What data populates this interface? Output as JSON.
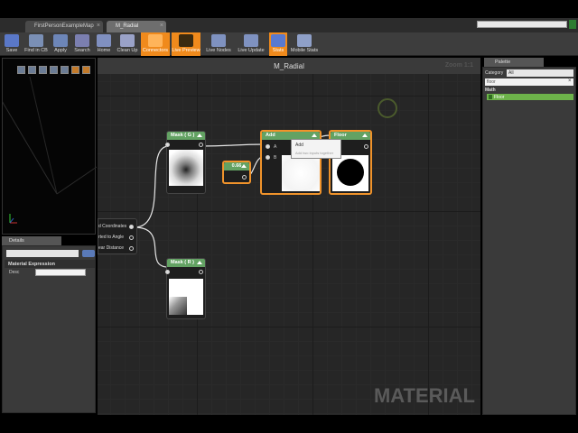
{
  "tabs": [
    {
      "label": "FirstPersonExampleMap"
    },
    {
      "label": "M_Radial"
    }
  ],
  "toolbar": [
    {
      "label": "Save",
      "icon": "save-icon",
      "color": "#5a78c8",
      "active": false
    },
    {
      "label": "Find in CB",
      "icon": "find-icon",
      "color": "#7a8fb5",
      "active": false
    },
    {
      "label": "Apply",
      "icon": "apply-icon",
      "color": "#6d86b8",
      "active": false
    },
    {
      "label": "Search",
      "icon": "search-icon",
      "color": "#7b7fb0",
      "active": false
    },
    {
      "label": "Home",
      "icon": "home-icon",
      "color": "#8090c0",
      "active": false
    },
    {
      "label": "Clean Up",
      "icon": "cleanup-icon",
      "color": "#9aa2c8",
      "active": false
    },
    {
      "label": "Connectors",
      "icon": "connectors-icon",
      "color": "#ffb45a",
      "active": true
    },
    {
      "label": "Live Preview",
      "icon": "live-preview-icon",
      "color": "#3a2a10",
      "active": true
    },
    {
      "label": "Live Nodes",
      "icon": "live-nodes-icon",
      "color": "#7f92c0",
      "active": false
    },
    {
      "label": "Live Update",
      "icon": "live-update-icon",
      "color": "#7f92c0",
      "active": false
    },
    {
      "label": "Stats",
      "icon": "stats-icon",
      "color": "#5a7ad0",
      "active": true
    },
    {
      "label": "Mobile Stats",
      "icon": "mobile-stats-icon",
      "color": "#8fa0c8",
      "active": false
    }
  ],
  "details": {
    "tab": "Details",
    "section": "Material Expression",
    "desc_label": "Desc"
  },
  "graph": {
    "title": "M_Radial",
    "zoom": "Zoom 1:1",
    "watermark": "MATERIAL",
    "mask_top": "Mask ( G )",
    "mask_bottom": "Mask ( R )",
    "constant_value": "0.66",
    "add_title": "Add",
    "add_pin_a": "A",
    "add_pin_b": "B",
    "floor_title": "Floor",
    "texcoord_rows": [
      "d Coordinates",
      "rted to Angle",
      "ear Distance"
    ],
    "context_title": "Add",
    "context_sub": "Add two inputs together"
  },
  "palette": {
    "tab": "Palette",
    "category_label": "Category",
    "category_value": "All",
    "search_value": "floor",
    "section": "Math",
    "item": "Floor"
  }
}
